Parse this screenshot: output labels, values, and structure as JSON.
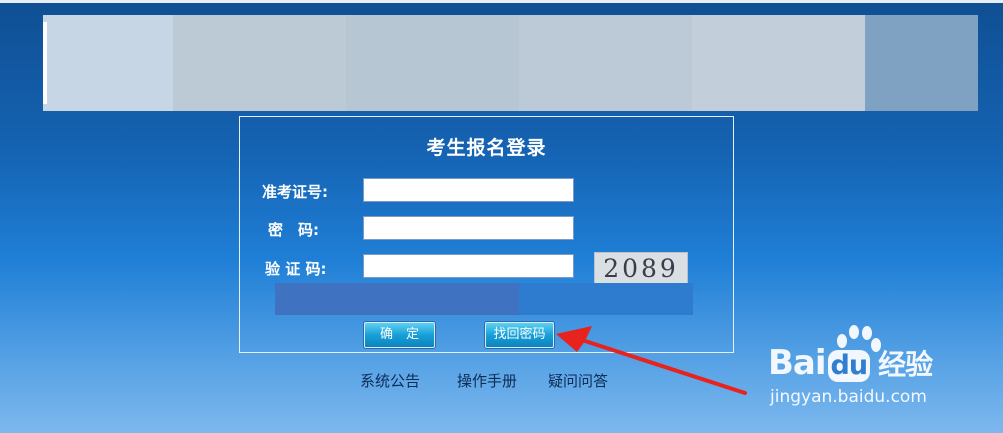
{
  "login": {
    "title": "考生报名登录",
    "exam_id_label": "准考证号:",
    "password_label": "密　码:",
    "captcha_label": "验 证 码:",
    "exam_id_value": "",
    "password_value": "",
    "captcha_value": "",
    "captcha_image_text": "2089",
    "confirm_label": "确　定",
    "recover_label": "找回密码"
  },
  "footer_links": [
    "系统公告",
    "操作手册",
    "疑问问答"
  ],
  "watermark": {
    "logo_text_part1": "Bai",
    "logo_text_part2": "du",
    "logo_suffix": "经验",
    "url": "jingyan.baidu.com"
  },
  "colors": {
    "background_top": "#0f4f93",
    "background_bottom": "#7db8ee",
    "button": "#17a0d8",
    "arrow": "#e8231e"
  },
  "icons": {
    "arrow": "red-arrow-icon",
    "paw": "baidu-paw-icon"
  }
}
